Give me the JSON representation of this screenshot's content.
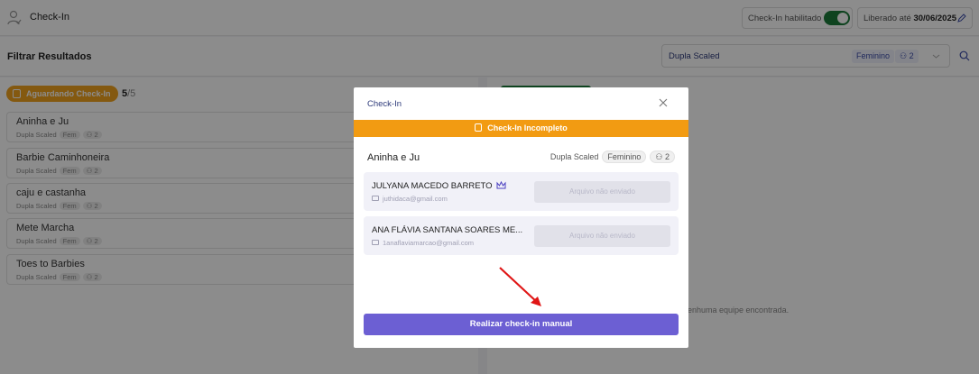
{
  "header": {
    "title": "Check-In",
    "checkin_enabled_label": "Check-In habilitado",
    "checkin_enabled": true,
    "released_label": "Liberado até",
    "released_date": "30/06/2025"
  },
  "filters": {
    "title": "Filtrar Resultados",
    "category_value": "Dupla Scaled",
    "gender_chip": "Feminino",
    "size_chip": "2"
  },
  "waiting": {
    "badge_label": "Aguardando Check-In",
    "count": "5",
    "total": "/5",
    "teams": [
      {
        "name": "Aninha e Ju",
        "category": "Dupla Scaled",
        "gender": "Fem",
        "size": "2"
      },
      {
        "name": "Barbie Caminhoneira",
        "category": "Dupla Scaled",
        "gender": "Fem",
        "size": "2"
      },
      {
        "name": "caju e castanha",
        "category": "Dupla Scaled",
        "gender": "Fem",
        "size": "2"
      },
      {
        "name": "Mete Marcha",
        "category": "Dupla Scaled",
        "gender": "Fem",
        "size": "2"
      },
      {
        "name": "Toes to Barbies",
        "category": "Dupla Scaled",
        "gender": "Fem",
        "size": "2"
      }
    ]
  },
  "checked": {
    "empty_text": "enhuma equipe encontrada."
  },
  "modal": {
    "title": "Check-In",
    "status_banner": "Check-In Incompleto",
    "team_name": "Aninha e Ju",
    "category": "Dupla Scaled",
    "gender": "Feminino",
    "size": "2",
    "members": [
      {
        "name": "JULYANA MACEDO BARRETO",
        "email": "juthidaca@gmail.com",
        "file_status": "Arquivo não enviado",
        "captain": true
      },
      {
        "name": "ANA FLÁVIA SANTANA SOARES ME...",
        "email": "1anaflaviamarcao@gmail.com",
        "file_status": "Arquivo não enviado",
        "captain": false
      }
    ],
    "action_label": "Realizar check-in manual"
  },
  "colors": {
    "accent": "#6c5fd3",
    "warning": "#f29b12",
    "success": "#1b7a3a"
  }
}
